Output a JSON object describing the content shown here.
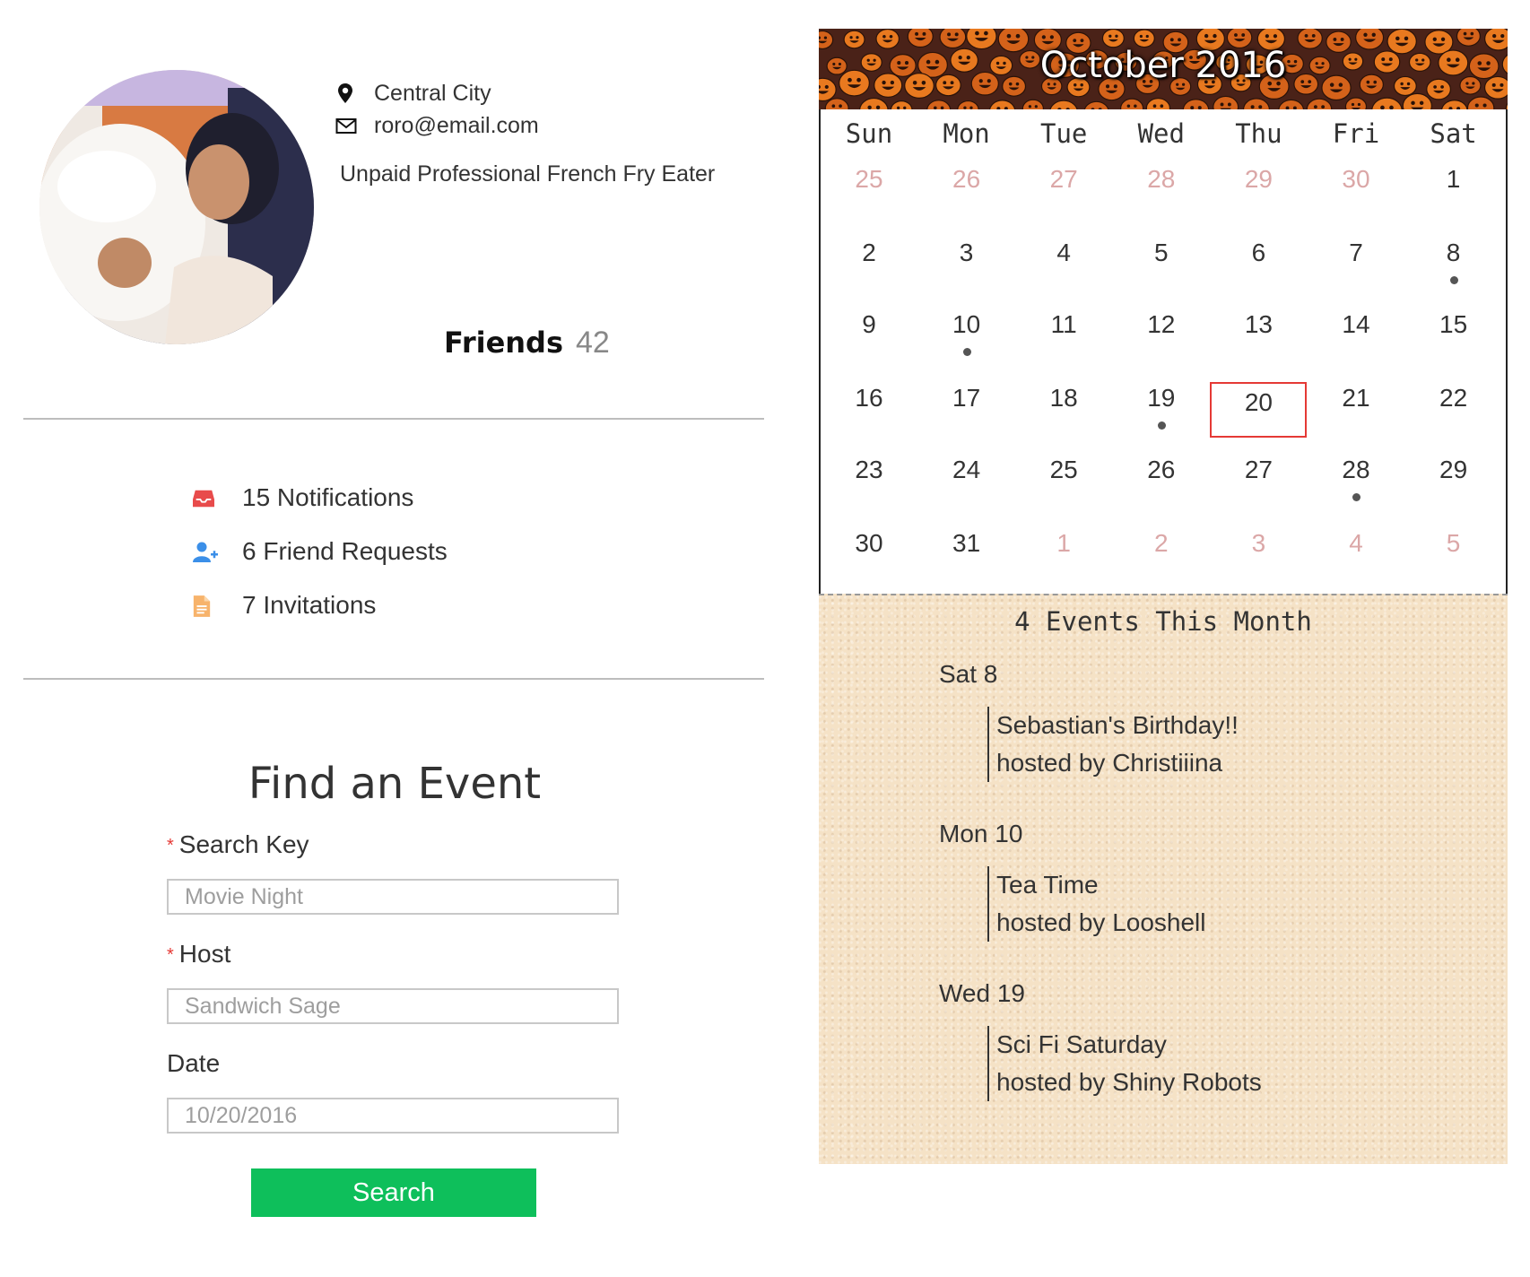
{
  "profile": {
    "location": "Central City",
    "email": "roro@email.com",
    "bio": "Unpaid Professional French Fry Eater",
    "friends_label": "Friends",
    "friends_count": "42"
  },
  "stats": {
    "notifications": "15 Notifications",
    "friend_requests": "6 Friend Requests",
    "invitations": "7 Invitations"
  },
  "find_event": {
    "title": "Find an Event",
    "required_mark": "*",
    "search_key_label": "Search Key",
    "search_key_placeholder": "Movie Night",
    "host_label": "Host",
    "host_placeholder": "Sandwich Sage",
    "date_label": "Date",
    "date_placeholder": "10/20/2016",
    "search_button": "Search"
  },
  "calendar": {
    "title": "October 2016",
    "weekdays": [
      "Sun",
      "Mon",
      "Tue",
      "Wed",
      "Thu",
      "Fri",
      "Sat"
    ],
    "weeks": [
      [
        {
          "d": "25",
          "o": true
        },
        {
          "d": "26",
          "o": true
        },
        {
          "d": "27",
          "o": true
        },
        {
          "d": "28",
          "o": true
        },
        {
          "d": "29",
          "o": true
        },
        {
          "d": "30",
          "o": true
        },
        {
          "d": "1"
        }
      ],
      [
        {
          "d": "2"
        },
        {
          "d": "3"
        },
        {
          "d": "4"
        },
        {
          "d": "5"
        },
        {
          "d": "6"
        },
        {
          "d": "7"
        },
        {
          "d": "8",
          "ev": true
        }
      ],
      [
        {
          "d": "9"
        },
        {
          "d": "10",
          "ev": true
        },
        {
          "d": "11"
        },
        {
          "d": "12"
        },
        {
          "d": "13"
        },
        {
          "d": "14"
        },
        {
          "d": "15"
        }
      ],
      [
        {
          "d": "16"
        },
        {
          "d": "17"
        },
        {
          "d": "18"
        },
        {
          "d": "19",
          "ev": true
        },
        {
          "d": "20",
          "today": true
        },
        {
          "d": "21"
        },
        {
          "d": "22"
        }
      ],
      [
        {
          "d": "23"
        },
        {
          "d": "24"
        },
        {
          "d": "25"
        },
        {
          "d": "26"
        },
        {
          "d": "27"
        },
        {
          "d": "28",
          "ev": true
        },
        {
          "d": "29"
        }
      ],
      [
        {
          "d": "30"
        },
        {
          "d": "31"
        },
        {
          "d": "1",
          "o": true
        },
        {
          "d": "2",
          "o": true
        },
        {
          "d": "3",
          "o": true
        },
        {
          "d": "4",
          "o": true
        },
        {
          "d": "5",
          "o": true
        }
      ]
    ],
    "colors": {
      "today_border": "#e53935",
      "other_month": "#dba7a7",
      "event_dot": "#555555"
    },
    "events_header": "4 Events This Month",
    "events": [
      {
        "date": "Sat 8",
        "name": "Sebastian's Birthday!!",
        "host": "hosted by Christiiina"
      },
      {
        "date": "Mon 10",
        "name": "Tea Time",
        "host": "hosted by Looshell"
      },
      {
        "date": "Wed 19",
        "name": "Sci Fi Saturday",
        "host": "hosted by Shiny Robots"
      }
    ]
  },
  "icons": {
    "location": "map-marker-icon",
    "email": "envelope-icon",
    "notifications": "inbox-icon",
    "friend_requests": "user-plus-icon",
    "invitations": "document-icon"
  },
  "accent": {
    "search_button": "#0ebf5b",
    "notifications_icon": "#e84b4b",
    "friend_requests_icon": "#3b8fe8",
    "invitations_icon": "#f7b36b"
  }
}
